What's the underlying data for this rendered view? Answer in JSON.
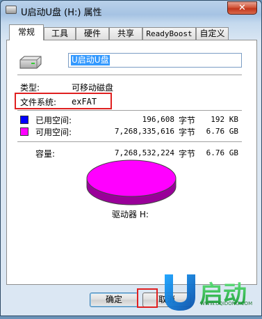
{
  "window": {
    "title": "U启动U盘 (H:) 属性",
    "close_label": "✕"
  },
  "tabs": [
    {
      "label": "常规"
    },
    {
      "label": "工具"
    },
    {
      "label": "硬件"
    },
    {
      "label": "共享"
    },
    {
      "label": "ReadyBoost"
    },
    {
      "label": "自定义"
    }
  ],
  "general": {
    "drive_name": "U启动U盘",
    "type_label": "类型:",
    "type_value": "可移动磁盘",
    "fs_label": "文件系统:",
    "fs_value": "exFAT"
  },
  "space": {
    "used": {
      "label": "已用空间:",
      "bytes": "196,608",
      "unit": "字节",
      "human": "192 KB",
      "color": "#0000ff"
    },
    "free": {
      "label": "可用空间:",
      "bytes": "7,268,335,616",
      "unit": "字节",
      "human": "6.76 GB",
      "color": "#ff00ff"
    },
    "capacity": {
      "label": "容量:",
      "bytes": "7,268,532,224",
      "unit": "字节",
      "human": "6.76 GB"
    },
    "drive_caption": "驱动器 H:"
  },
  "buttons": {
    "ok": "确定",
    "cancel": "取消"
  },
  "watermark": {
    "brand": "U启动",
    "url": "WWW.UQIDONG.COM"
  }
}
